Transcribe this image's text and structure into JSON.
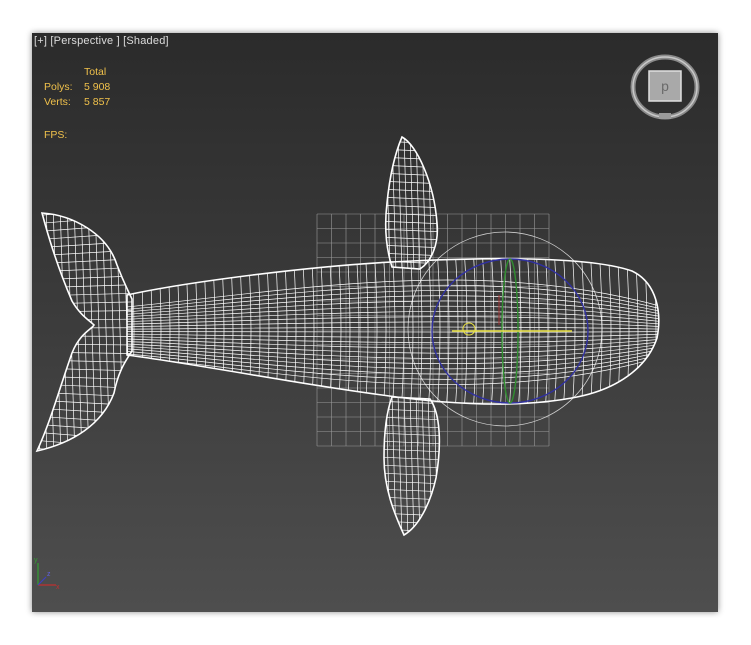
{
  "viewport": {
    "label_plus": "[+]",
    "label_view": "[Perspective ]",
    "label_shading": "[Shaded]"
  },
  "stats": {
    "header": "Total",
    "polys_label": "Polys:",
    "polys_value": "5 908",
    "verts_label": "Verts:",
    "verts_value": "5 857",
    "fps_label": "FPS:"
  },
  "viewcube": {
    "face_label": "р"
  },
  "axis_gizmo": {
    "x_label": "x",
    "y_label": "y",
    "z_label": "z"
  },
  "colors": {
    "stats_text": "#f0c14b",
    "wire": "#ffffff",
    "grid": "#9a9a9a",
    "gizmo_x": "#e8e040",
    "gizmo_y": "#2f8f2f",
    "gizmo_z": "#3030a0"
  }
}
